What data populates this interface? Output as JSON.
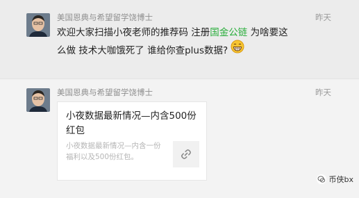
{
  "messages": [
    {
      "sender": "美国恩典与希望留学饶博士",
      "time": "昨天",
      "text_before": "欢迎大家扫描小夜老师的推荐码 注册",
      "link": "国金公链",
      "text_after": " 为啥要这么做 技术大咖饿死了 谁给你查plus数据?",
      "emoji": "grin-emoji"
    },
    {
      "sender": "美国恩典与希望留学饶博士",
      "time": "昨天",
      "card": {
        "title": "小夜数据最新情况—内含500份红包",
        "description": "小夜数据最新情况—内含一份福利以及500份红包。",
        "thumb_icon": "link-icon"
      }
    }
  ],
  "watermark": {
    "text": "币侠bx",
    "icon": "wechat-icon"
  }
}
